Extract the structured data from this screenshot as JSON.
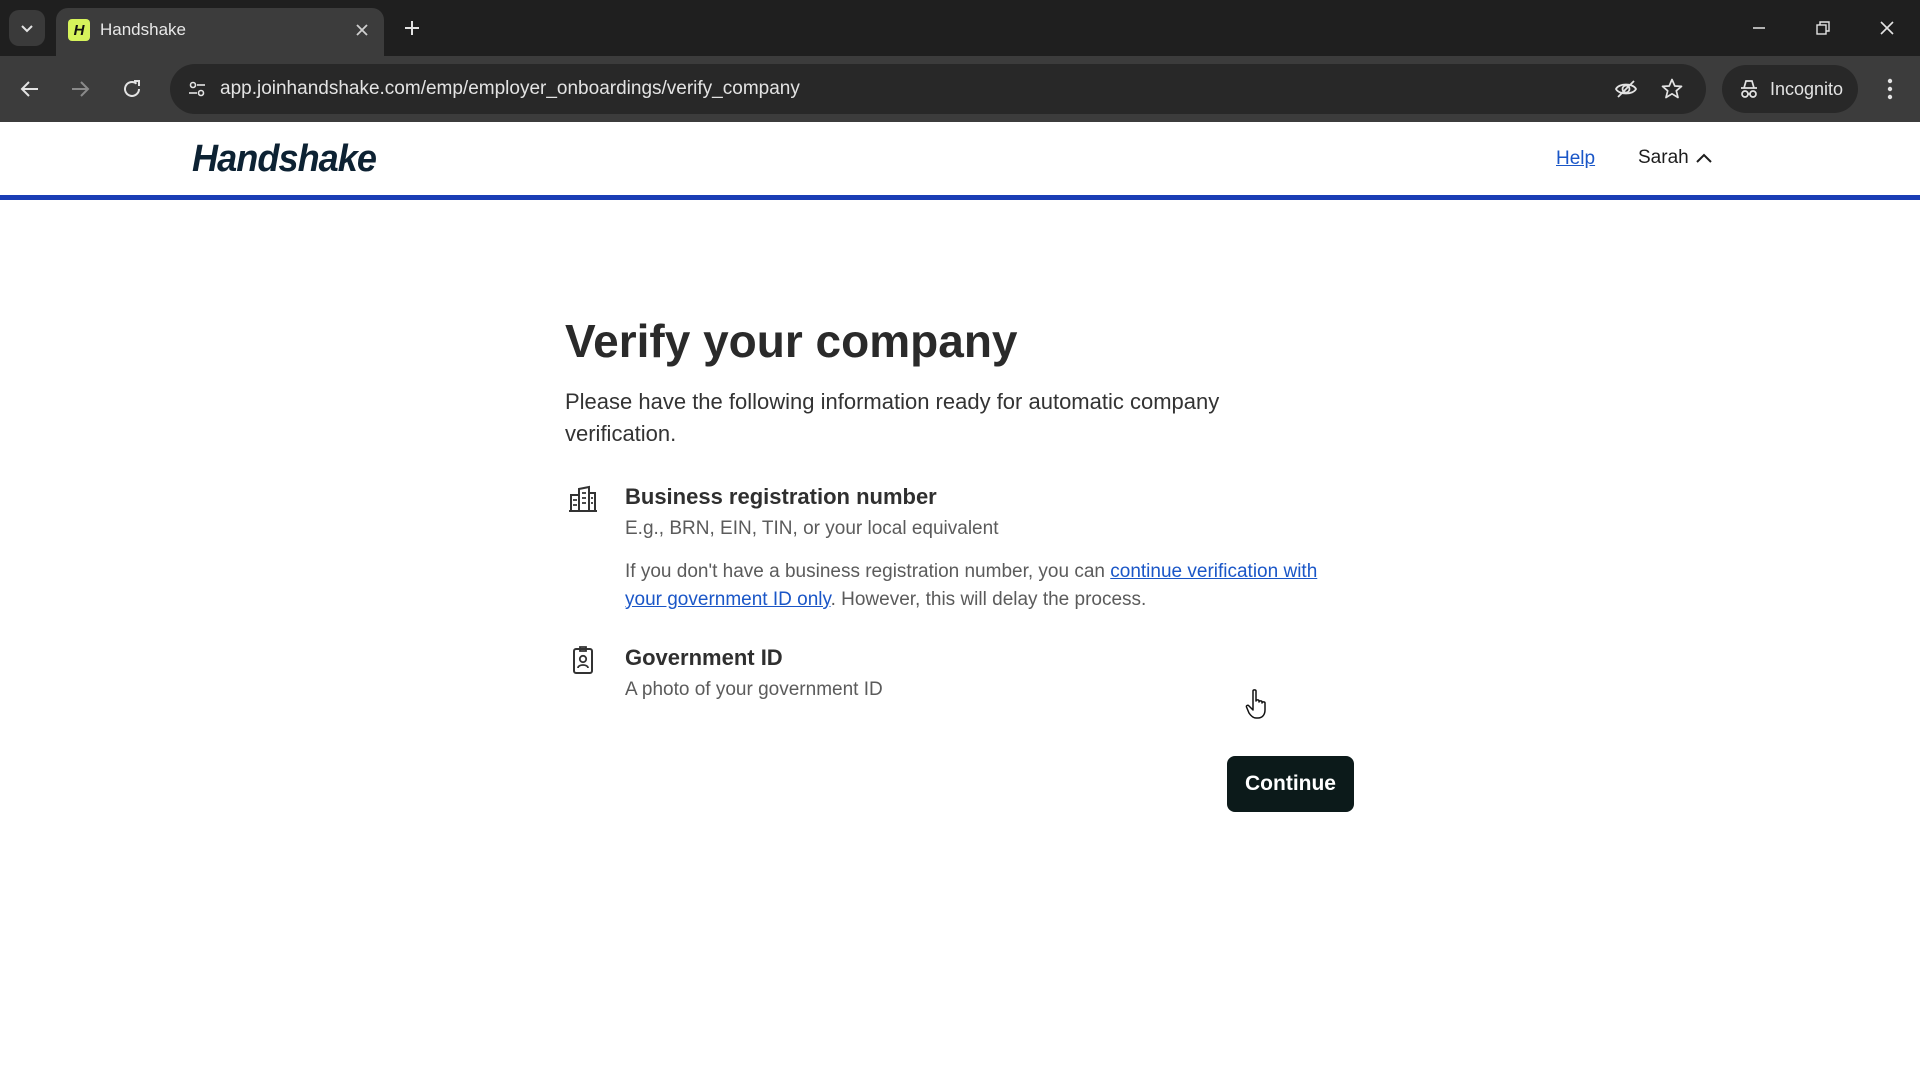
{
  "browser": {
    "tab_title": "Handshake",
    "favicon_letter": "H",
    "url": "app.joinhandshake.com/emp/employer_onboardings/verify_company",
    "incognito_label": "Incognito"
  },
  "header": {
    "logo": "Handshake",
    "help": "Help",
    "user": "Sarah"
  },
  "main": {
    "title": "Verify your company",
    "intro": "Please have the following information ready for automatic company verification.",
    "items": [
      {
        "title": "Business registration number",
        "desc": "E.g., BRN, EIN, TIN, or your local equivalent",
        "note_prefix": "If you don't have a business registration number, you can ",
        "note_link": "continue verification with your government ID only",
        "note_suffix": ". However, this will delay the process."
      },
      {
        "title": "Government ID",
        "desc": "A photo of your government ID"
      }
    ],
    "continue": "Continue"
  },
  "colors": {
    "accent_bar": "#1a3db5",
    "link": "#1a56c7",
    "button": "#0c1a1a",
    "favicon": "#d6f35b"
  }
}
